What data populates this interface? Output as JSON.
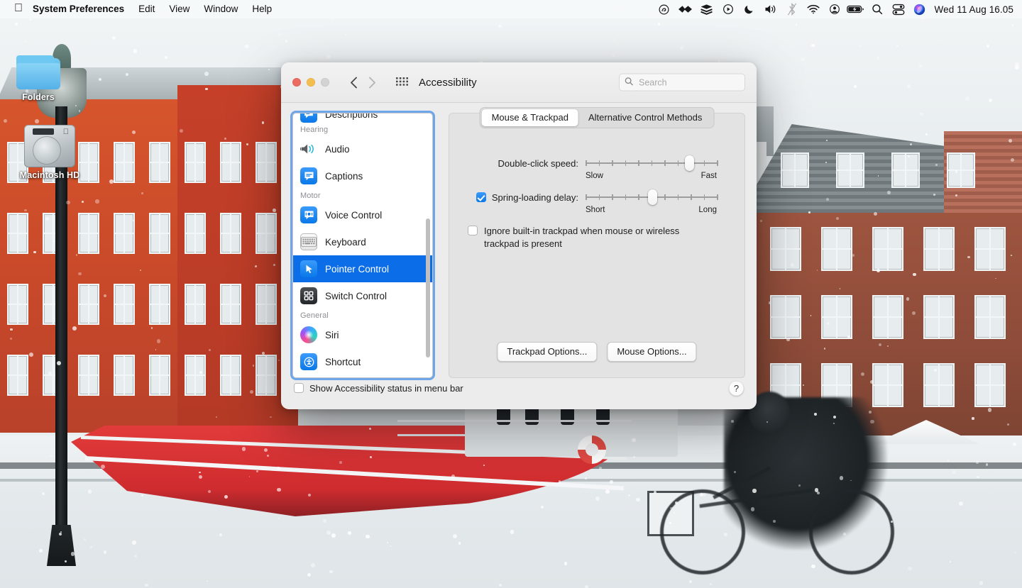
{
  "menubar": {
    "apple_icon": "apple-logo",
    "items": [
      {
        "label": "System Preferences",
        "bold": true
      },
      {
        "label": "Edit",
        "bold": false
      },
      {
        "label": "View",
        "bold": false
      },
      {
        "label": "Window",
        "bold": false
      },
      {
        "label": "Help",
        "bold": false
      }
    ],
    "status_icons": [
      "creative-cloud-icon",
      "dropbox-icon",
      "backup-icon",
      "play-circle-icon",
      "do-not-disturb-moon-icon",
      "volume-icon",
      "bluetooth-off-icon",
      "wifi-icon",
      "user-account-icon",
      "battery-charging-icon",
      "search-spotlight-icon",
      "control-center-icon",
      "siri-icon"
    ],
    "clock": "Wed 11 Aug  16.05"
  },
  "desktop": {
    "icons": [
      {
        "label": "Folders",
        "icon": "folder-icon"
      },
      {
        "label": "Macintosh HD",
        "icon": "hard-drive-icon"
      }
    ]
  },
  "window": {
    "title": "Accessibility",
    "traffic_lights": [
      "close-button",
      "minimize-button",
      "zoom-button"
    ],
    "nav": {
      "back": "back-chevron-icon",
      "forward": "forward-chevron-icon",
      "grid": "show-all-grid-icon"
    },
    "search": {
      "placeholder": "Search",
      "value": "",
      "icon": "search-icon"
    },
    "footer": {
      "checkbox_label": "Show Accessibility status in menu bar",
      "checkbox_checked": false,
      "help_label": "?"
    }
  },
  "sidebar": {
    "partial_top_item": {
      "label": "Descriptions",
      "icon": "descriptions-icon"
    },
    "groups": [
      {
        "header": "Hearing",
        "items": [
          {
            "label": "Audio",
            "icon": "audio-icon",
            "selected": false
          },
          {
            "label": "Captions",
            "icon": "captions-icon",
            "selected": false
          }
        ]
      },
      {
        "header": "Motor",
        "items": [
          {
            "label": "Voice Control",
            "icon": "voice-control-icon",
            "selected": false
          },
          {
            "label": "Keyboard",
            "icon": "keyboard-icon",
            "selected": false
          },
          {
            "label": "Pointer Control",
            "icon": "pointer-control-icon",
            "selected": true
          },
          {
            "label": "Switch Control",
            "icon": "switch-control-icon",
            "selected": false
          }
        ]
      },
      {
        "header": "General",
        "items": [
          {
            "label": "Siri",
            "icon": "siri-icon",
            "selected": false
          },
          {
            "label": "Shortcut",
            "icon": "shortcut-icon",
            "selected": false
          }
        ]
      }
    ],
    "selection_color": "#0b6ee8"
  },
  "main": {
    "tabs": [
      {
        "label": "Mouse & Trackpad",
        "active": true
      },
      {
        "label": "Alternative Control Methods",
        "active": false
      }
    ],
    "double_click": {
      "label": "Double-click speed:",
      "min_label": "Slow",
      "max_label": "Fast",
      "ticks": 11,
      "value_percent": 79
    },
    "spring_loading": {
      "label": "Spring-loading delay:",
      "min_label": "Short",
      "max_label": "Long",
      "ticks": 11,
      "value_percent": 51,
      "checked": true
    },
    "ignore_trackpad": {
      "label": "Ignore built-in trackpad when mouse or wireless trackpad is present",
      "checked": false
    },
    "buttons": [
      {
        "label": "Trackpad Options..."
      },
      {
        "label": "Mouse Options..."
      }
    ]
  }
}
